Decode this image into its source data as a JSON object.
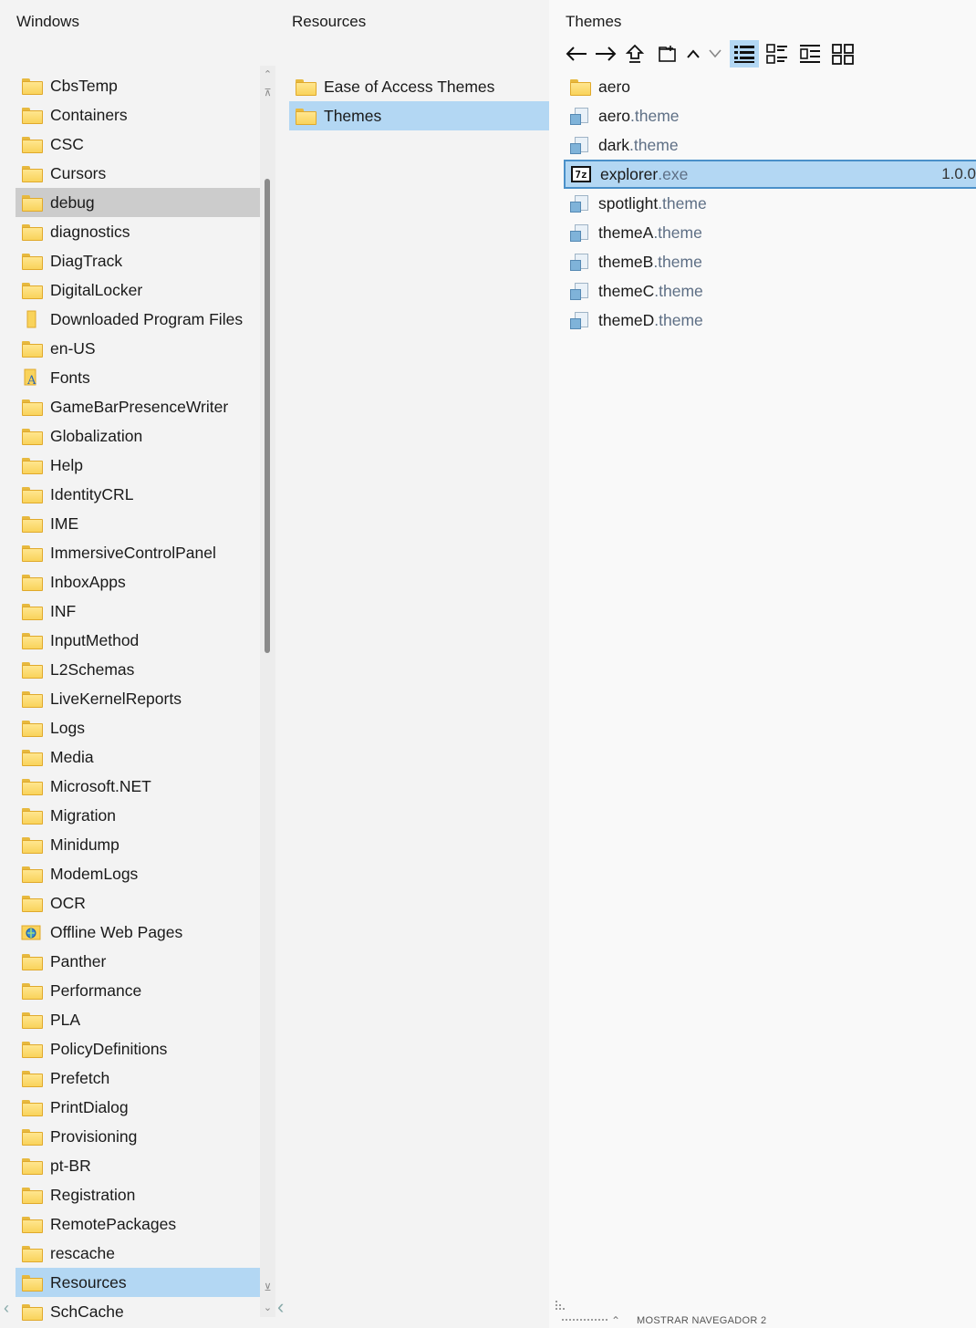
{
  "panes": {
    "windows": {
      "title": "Windows",
      "items": [
        {
          "name": "CbsTemp",
          "icon": "folder-icon"
        },
        {
          "name": "Containers",
          "icon": "folder-icon"
        },
        {
          "name": "CSC",
          "icon": "folder-icon"
        },
        {
          "name": "Cursors",
          "icon": "folder-icon"
        },
        {
          "name": "debug",
          "icon": "folder-icon",
          "state": "hover"
        },
        {
          "name": "diagnostics",
          "icon": "folder-icon"
        },
        {
          "name": "DiagTrack",
          "icon": "folder-icon"
        },
        {
          "name": "DigitalLocker",
          "icon": "folder-icon"
        },
        {
          "name": "Downloaded Program Files",
          "icon": "folder-special-icon"
        },
        {
          "name": "en-US",
          "icon": "folder-icon"
        },
        {
          "name": "Fonts",
          "icon": "fonts-folder-icon"
        },
        {
          "name": "GameBarPresenceWriter",
          "icon": "folder-icon"
        },
        {
          "name": "Globalization",
          "icon": "folder-icon"
        },
        {
          "name": "Help",
          "icon": "folder-icon"
        },
        {
          "name": "IdentityCRL",
          "icon": "folder-icon"
        },
        {
          "name": "IME",
          "icon": "folder-icon"
        },
        {
          "name": "ImmersiveControlPanel",
          "icon": "folder-icon"
        },
        {
          "name": "InboxApps",
          "icon": "folder-icon"
        },
        {
          "name": "INF",
          "icon": "folder-icon"
        },
        {
          "name": "InputMethod",
          "icon": "folder-icon"
        },
        {
          "name": "L2Schemas",
          "icon": "folder-icon"
        },
        {
          "name": "LiveKernelReports",
          "icon": "folder-icon"
        },
        {
          "name": "Logs",
          "icon": "folder-icon"
        },
        {
          "name": "Media",
          "icon": "folder-icon"
        },
        {
          "name": "Microsoft.NET",
          "icon": "folder-icon"
        },
        {
          "name": "Migration",
          "icon": "folder-icon"
        },
        {
          "name": "Minidump",
          "icon": "folder-icon"
        },
        {
          "name": "ModemLogs",
          "icon": "folder-icon"
        },
        {
          "name": "OCR",
          "icon": "folder-icon"
        },
        {
          "name": "Offline Web Pages",
          "icon": "offline-pages-icon"
        },
        {
          "name": "Panther",
          "icon": "folder-icon"
        },
        {
          "name": "Performance",
          "icon": "folder-icon"
        },
        {
          "name": "PLA",
          "icon": "folder-icon"
        },
        {
          "name": "PolicyDefinitions",
          "icon": "folder-icon"
        },
        {
          "name": "Prefetch",
          "icon": "folder-icon"
        },
        {
          "name": "PrintDialog",
          "icon": "folder-icon"
        },
        {
          "name": "Provisioning",
          "icon": "folder-icon"
        },
        {
          "name": "pt-BR",
          "icon": "folder-icon"
        },
        {
          "name": "Registration",
          "icon": "folder-icon"
        },
        {
          "name": "RemotePackages",
          "icon": "folder-icon"
        },
        {
          "name": "rescache",
          "icon": "folder-icon"
        },
        {
          "name": "Resources",
          "icon": "folder-icon",
          "state": "selected"
        },
        {
          "name": "SchCache",
          "icon": "folder-icon"
        }
      ]
    },
    "resources": {
      "title": "Resources",
      "items": [
        {
          "name": "Ease of Access Themes",
          "icon": "folder-icon"
        },
        {
          "name": "Themes",
          "icon": "folder-icon",
          "state": "selected"
        }
      ]
    },
    "themes": {
      "title": "Themes",
      "toolbar": [
        "back-arrow-icon",
        "forward-arrow-icon",
        "up-folder-icon",
        "new-folder-icon",
        "chevron-up-icon",
        "chevron-down-icon",
        "details-view-icon",
        "list-view-icon",
        "tree-view-icon",
        "tiles-view-icon"
      ],
      "active_view": "details-view-icon",
      "items": [
        {
          "base": "aero",
          "ext": "",
          "icon": "folder-icon"
        },
        {
          "base": "aero",
          "ext": ".theme",
          "icon": "theme-file-icon"
        },
        {
          "base": "dark",
          "ext": ".theme",
          "icon": "theme-file-icon"
        },
        {
          "base": "explorer",
          "ext": ".exe",
          "icon": "7z-exe-icon",
          "state": "selected-focused",
          "value": "1.0.0",
          "icon_text": "7z"
        },
        {
          "base": "spotlight",
          "ext": ".theme",
          "icon": "theme-file-icon"
        },
        {
          "base": "themeA",
          "ext": ".theme",
          "icon": "theme-file-icon"
        },
        {
          "base": "themeB",
          "ext": ".theme",
          "icon": "theme-file-icon"
        },
        {
          "base": "themeC",
          "ext": ".theme",
          "icon": "theme-file-icon"
        },
        {
          "base": "themeD",
          "ext": ".theme",
          "icon": "theme-file-icon"
        }
      ]
    }
  },
  "statusbar": {
    "label": "MOSTRAR NAVEGADOR 2"
  },
  "colors": {
    "selection": "#b3d7f3",
    "hover": "#cccccc",
    "focus_border": "#4a90c9",
    "extension_text": "#5e6f85",
    "folder": "#f9d35b"
  }
}
